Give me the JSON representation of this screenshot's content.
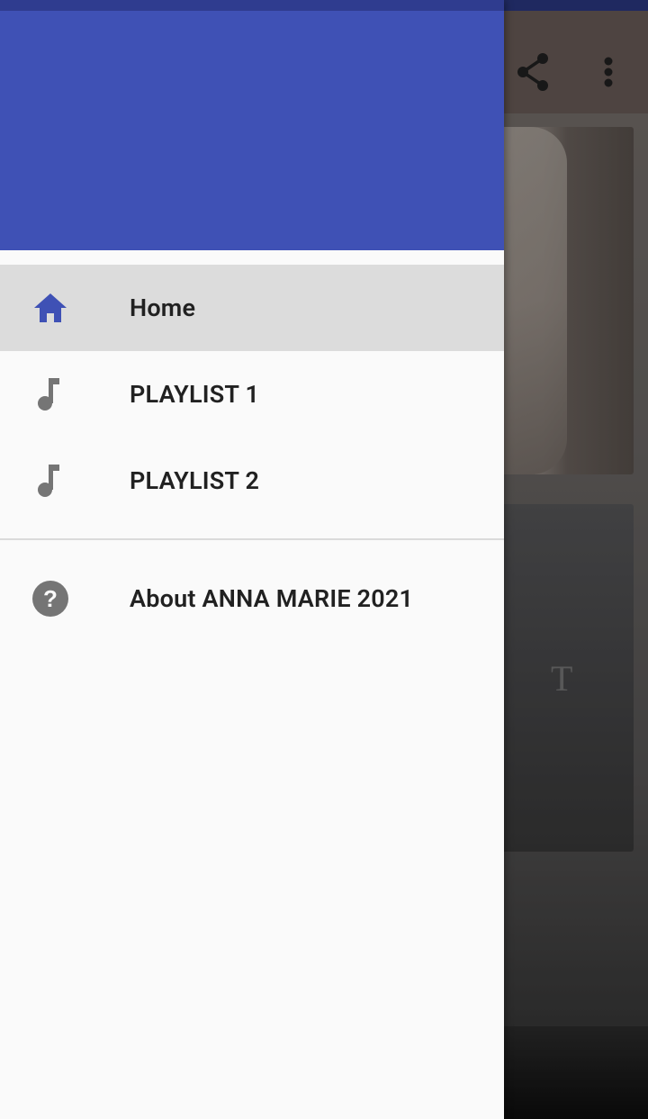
{
  "drawer": {
    "items": [
      {
        "label": "Home",
        "icon": "home-icon",
        "active": true
      },
      {
        "label": "PLAYLIST 1",
        "icon": "music-note-icon",
        "active": false
      },
      {
        "label": "PLAYLIST 2",
        "icon": "music-note-icon",
        "active": false
      }
    ],
    "secondary_items": [
      {
        "label": "About ANNA MARIE 2021",
        "icon": "help-icon"
      }
    ]
  },
  "toolbar": {
    "actions": [
      "share-icon",
      "more-vert-icon"
    ]
  },
  "background_card": {
    "letter": "T"
  },
  "colors": {
    "primary": "#3f51b5",
    "primary_dark": "#2f3c8f",
    "drawer_bg": "#fafafa",
    "active_bg": "#dcdcdc",
    "icon_active": "#3f51b5",
    "icon_inactive": "#757575",
    "text": "#212121"
  }
}
